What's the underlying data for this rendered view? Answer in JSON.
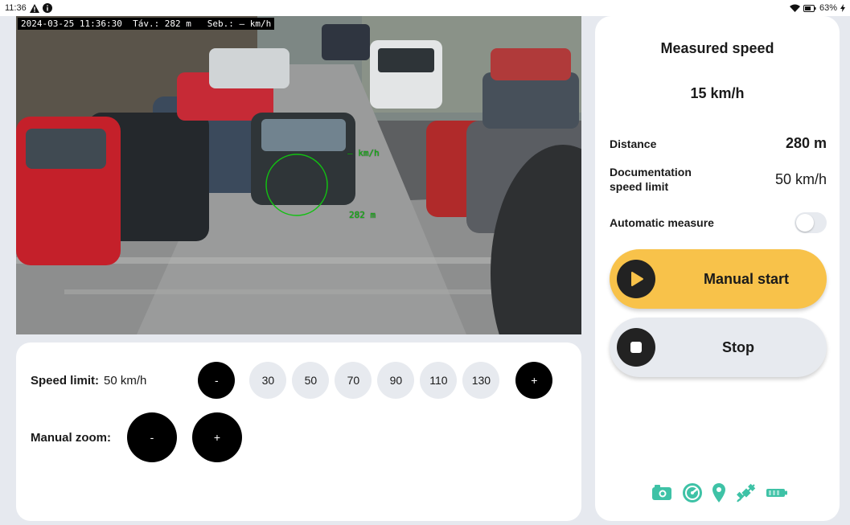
{
  "status_bar": {
    "time": "11:36",
    "battery_percent": "63%",
    "icons": [
      "warning-icon",
      "info-icon",
      "wifi-icon",
      "battery-icon",
      "charging-icon"
    ]
  },
  "camera": {
    "overlay_text": "2024-03-25 11:36:30  Táv.: 282 m   Seb.: — km/h",
    "target_speed_text": "— km/h",
    "target_distance_text": "282 m"
  },
  "controls": {
    "speed_limit_label": "Speed limit:",
    "speed_limit_value": "50 km/h",
    "decrease_label": "-",
    "increase_label": "+",
    "presets": [
      "30",
      "50",
      "70",
      "90",
      "110",
      "130"
    ],
    "zoom_label": "Manual zoom:",
    "zoom_out_label": "-",
    "zoom_in_label": "+"
  },
  "side_panel": {
    "title": "Measured speed",
    "measured_speed": "15 km/h",
    "distance_label": "Distance",
    "distance_value": "280 m",
    "doc_limit_label": "Documentation speed limit",
    "doc_limit_value": "50 km/h",
    "auto_measure_label": "Automatic measure",
    "auto_measure_enabled": false,
    "manual_start_label": "Manual start",
    "stop_label": "Stop",
    "indicator_icons": [
      "camera-icon",
      "gauge-icon",
      "location-icon",
      "satellite-off-icon",
      "battery-status-icon"
    ]
  },
  "colors": {
    "accent": "#f8c24a",
    "indicator": "#3ec2a6",
    "button_dark": "#000000",
    "button_light": "#e7eaef",
    "overlay_green": "#10c010"
  }
}
